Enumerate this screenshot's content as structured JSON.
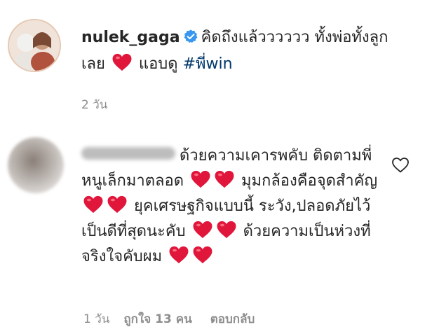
{
  "post": {
    "username": "nulek_gaga",
    "avatar_icon": "profile-photo-couple",
    "verified_icon": "verified-badge-icon",
    "text_part1": "คิดถึงแล้วววววว ทั้งพ่อทั้งลูกเลย",
    "text_part2": "แอบดู",
    "hashtag": "#พี่win",
    "heart_icon": "red-heart-emoji",
    "timestamp": "2 วัน"
  },
  "comment": {
    "avatar_icon": "blurred-avatar",
    "username_hidden": true,
    "segment1": "ด้วยความเคารพคับ ติดตามพี่หนูเล็กมาตลอด",
    "segment2": "มุมกล้องคือจุดสำคัญ",
    "segment3": "ยุคเศรษฐกิจแบบนี้ ระวัง,ปลอดภัยไว้ เป็นดีที่สุดนะคับ",
    "segment4": "ด้วยความเป็นห่วงที่จริงใจคับผม",
    "heart_icon": "red-heart-emoji",
    "like_icon": "heart-outline-icon",
    "timestamp": "1 วัน",
    "likes_label": "ถูกใจ 13 คน",
    "reply_label": "ตอบกลับ"
  },
  "colors": {
    "text": "#262626",
    "muted": "#8e8e8e",
    "hashtag": "#00376b",
    "verified": "#3897f0",
    "heart": "#e0163b"
  }
}
